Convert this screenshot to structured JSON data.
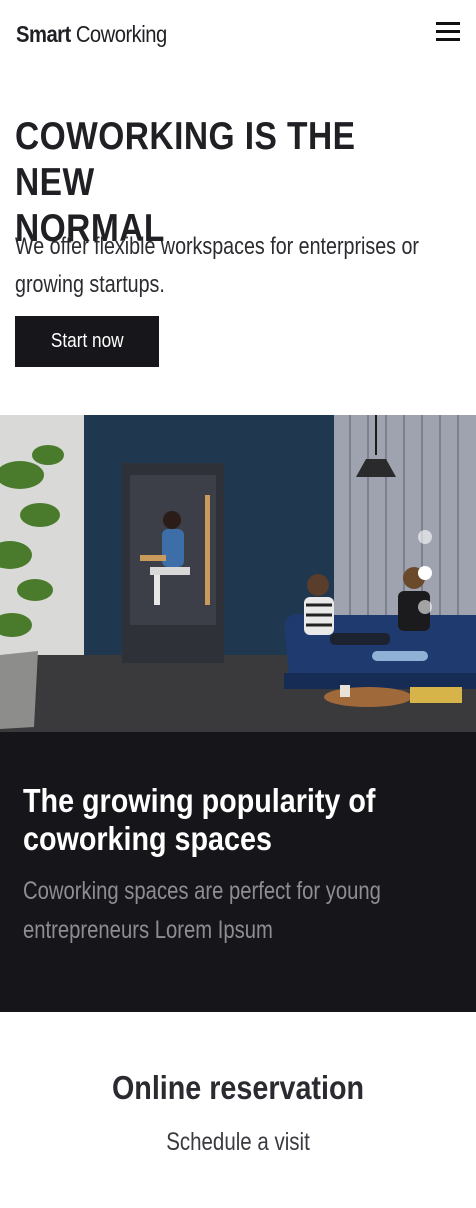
{
  "header": {
    "brand_bold": "Smart",
    "brand_light": "Coworking",
    "menu_icon": "hamburger-menu-icon"
  },
  "hero": {
    "title": "COWORKING IS THE NEW\nNORMAL",
    "subtitle": "We offer flexible workspaces for enterprises or growing startups.",
    "cta_label": "Start now"
  },
  "carousel": {
    "image": "coworking-lounge-photo",
    "slide_count": 3,
    "active_slide": 2
  },
  "feature": {
    "title": "The growing popularity of\ncoworking spaces",
    "text": "Coworking spaces are perfect for young\nentrepreneurs Lorem Ipsum",
    "background": "#16151a"
  },
  "reservation": {
    "title": "Online reservation",
    "subtitle": "Schedule a visit"
  },
  "colors": {
    "primary": "#17161b",
    "text": "#1f1f24",
    "muted": "#8e8d93"
  }
}
